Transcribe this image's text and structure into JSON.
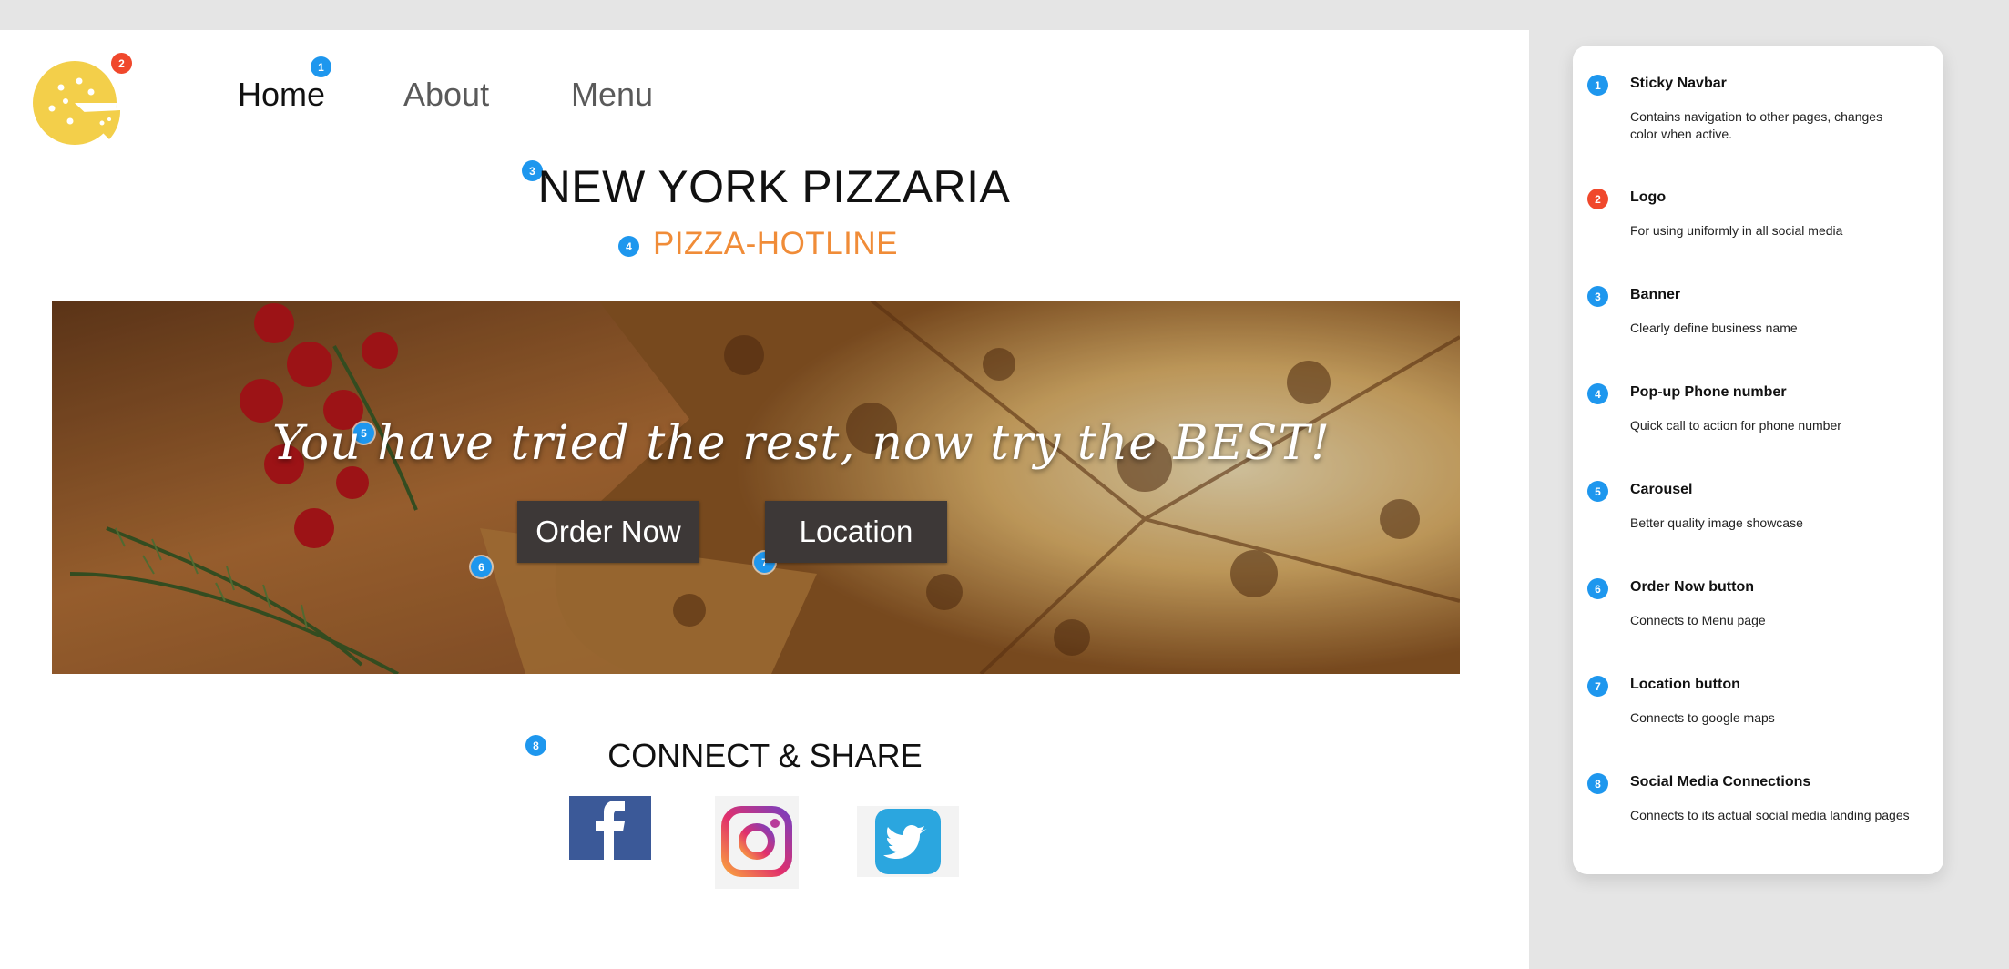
{
  "nav": {
    "logo_icon": "pizza-logo-icon",
    "links": [
      "Home",
      "About",
      "Menu"
    ],
    "active": "Home"
  },
  "banner": {
    "title": "NEW YORK PIZZARIA",
    "hotline": "PIZZA-HOTLINE"
  },
  "hero": {
    "tagline": "You have tried the rest, now try the BEST!",
    "order_label": "Order Now",
    "location_label": "Location"
  },
  "connect": {
    "title": "CONNECT & SHARE",
    "icons": [
      "facebook-icon",
      "instagram-icon",
      "twitter-icon"
    ]
  },
  "badges": [
    "1",
    "2",
    "3",
    "4",
    "5",
    "6",
    "7",
    "8"
  ],
  "annotations": [
    {
      "num": "1",
      "title": "Sticky Navbar",
      "desc": "Contains navigation to other pages, changes color when active.",
      "color": "#1e97ee"
    },
    {
      "num": "2",
      "title": "Logo",
      "desc": "For using uniformly in all social media",
      "color": "#f0482c"
    },
    {
      "num": "3",
      "title": "Banner",
      "desc": "Clearly define business name",
      "color": "#1e97ee"
    },
    {
      "num": "4",
      "title": "Pop-up Phone number",
      "desc": "Quick call to action for phone number",
      "color": "#1e97ee"
    },
    {
      "num": "5",
      "title": "Carousel",
      "desc": "Better quality image showcase",
      "color": "#1e97ee"
    },
    {
      "num": "6",
      "title": "Order Now button",
      "desc": "Connects to Menu page",
      "color": "#1e97ee"
    },
    {
      "num": "7",
      "title": "Location button",
      "desc": "Connects to google maps",
      "color": "#1e97ee"
    },
    {
      "num": "8",
      "title": "Social Media Connections",
      "desc": "Connects to its actual social media landing pages",
      "color": "#1e97ee"
    }
  ],
  "colors": {
    "accent_orange": "#f08c38",
    "badge_blue": "#1e97ee",
    "badge_red": "#f0482c",
    "logo_yellow": "#f3cf4a",
    "button_bg": "#3d3837"
  }
}
